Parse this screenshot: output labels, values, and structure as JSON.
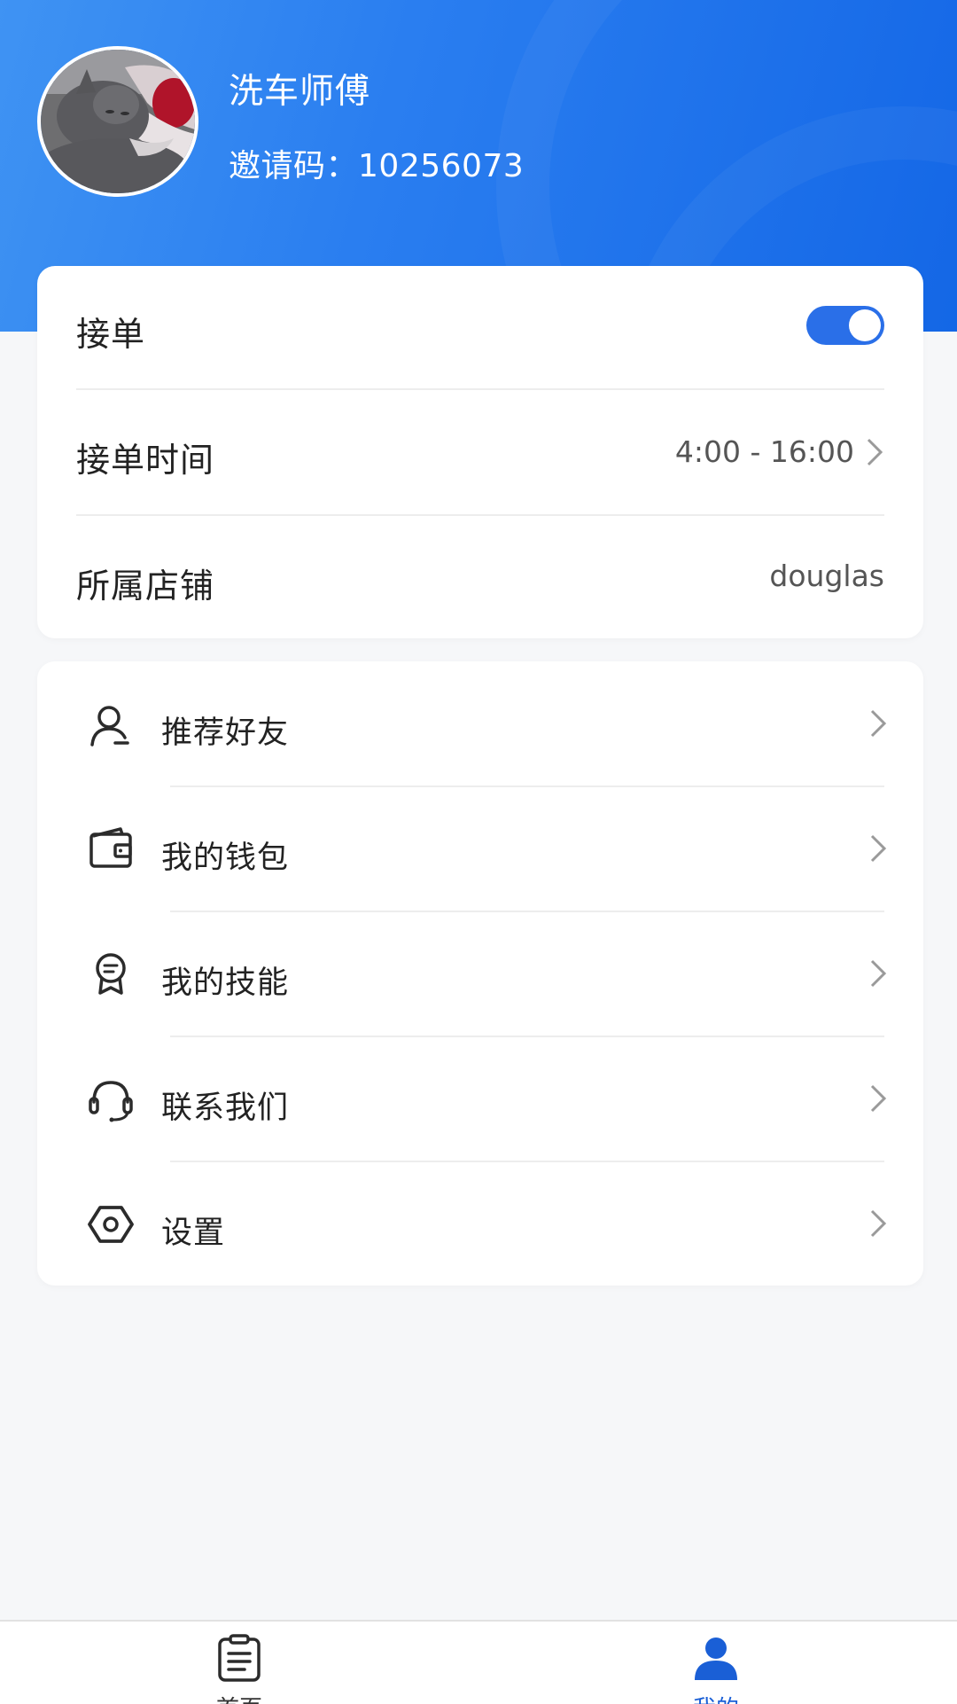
{
  "profile": {
    "name": "洗车师傅",
    "invite_code_label": "邀请码：",
    "invite_code": "10256073"
  },
  "settings_card": {
    "accept_orders": {
      "label": "接单",
      "enabled": true
    },
    "accept_hours": {
      "label": "接单时间",
      "value": "4:00 - 16:00"
    },
    "shop": {
      "label": "所属店铺",
      "value": "douglas"
    }
  },
  "menu": {
    "items": [
      {
        "label": "推荐好友",
        "icon": "user-referral-icon"
      },
      {
        "label": "我的钱包",
        "icon": "wallet-icon"
      },
      {
        "label": "我的技能",
        "icon": "skill-badge-icon"
      },
      {
        "label": "联系我们",
        "icon": "headset-icon"
      },
      {
        "label": "设置",
        "icon": "settings-hexagon-icon"
      }
    ]
  },
  "tabbar": {
    "tabs": [
      {
        "label": "首页",
        "icon": "clipboard-icon",
        "active": false
      },
      {
        "label": "我的",
        "icon": "person-icon",
        "active": true
      }
    ],
    "active_color": "#1a5fd6",
    "inactive_color": "#333333"
  },
  "colors": {
    "header_gradient_start": "#3f93f3",
    "header_gradient_end": "#1467e6",
    "toggle_on": "#2a6fe8",
    "page_background": "#f6f7f9"
  }
}
